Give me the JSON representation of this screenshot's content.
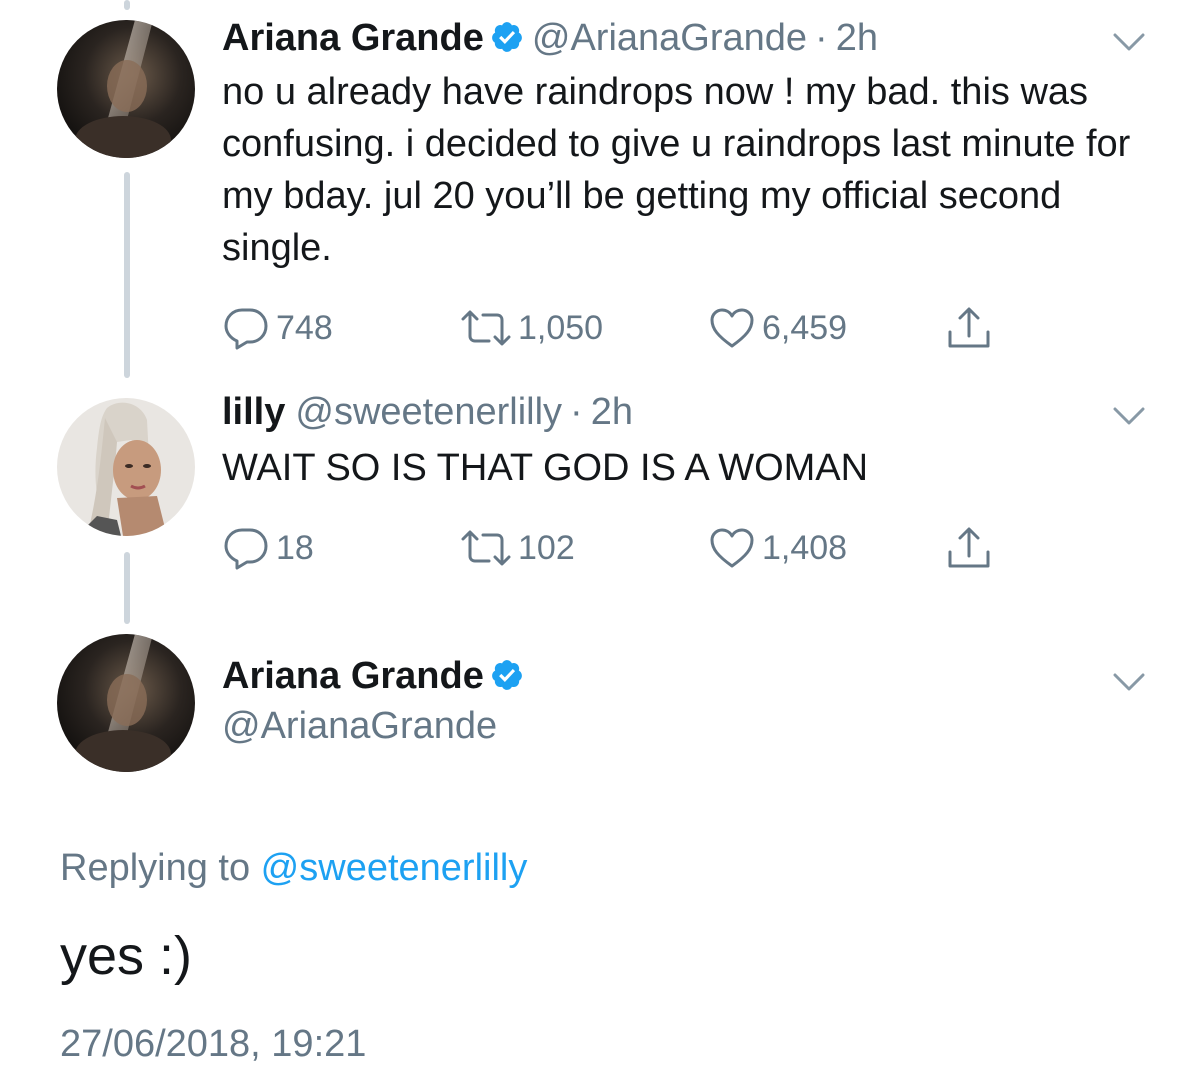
{
  "tweets": [
    {
      "name": "Ariana Grande",
      "handle": "@ArianaGrande",
      "separator": "·",
      "time": "2h",
      "text": "no u already have raindrops now ! my bad. this was confusing. i decided to give u raindrops last minute for my bday. jul 20 you’ll be getting my official second single.",
      "replies": "748",
      "retweets": "1,050",
      "likes": "6,459"
    },
    {
      "name": "lilly",
      "handle": "@sweetenerlilly",
      "separator": "·",
      "time": "2h",
      "text": "WAIT SO IS THAT GOD IS A WOMAN",
      "replies": "18",
      "retweets": "102",
      "likes": "1,408"
    }
  ],
  "focused": {
    "name": "Ariana Grande",
    "handle": "@ArianaGrande",
    "replying_prefix": "Replying to ",
    "replying_to": "@sweetenerlilly",
    "text": "yes :)",
    "timestamp": "27/06/2018, 19:21"
  },
  "colors": {
    "text": "#14171a",
    "secondary": "#657786",
    "link": "#1da1f2",
    "verified": "#1da1f2",
    "thread_line": "#cdd5dc"
  },
  "icons": [
    "verified-badge-icon",
    "chevron-down-icon",
    "reply-icon",
    "retweet-icon",
    "like-icon",
    "share-icon"
  ]
}
